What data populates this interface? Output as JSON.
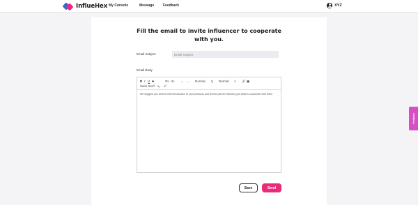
{
  "brand": {
    "name": "InflueHex",
    "accent": "#ea2a7b",
    "accent_secondary": "#2f6bd6"
  },
  "nav": {
    "links": [
      "My Console",
      "Message",
      "Feedback"
    ],
    "user": {
      "name": "XYZ",
      "icon": "user-circle-icon"
    }
  },
  "form": {
    "title_line1": "Fill the email to invite influencer to cooperate",
    "title_line2": "with you.",
    "subject_label": "Email Subject",
    "subject_placeholder": "Email Subject",
    "subject_value": "",
    "body_label": "Email Body",
    "toolbar": {
      "bold": "B",
      "italic": "I",
      "underline": "U",
      "strike": "S",
      "ordered_list": "OL",
      "bullet_list": "UL",
      "indent": "→",
      "outdent": "←",
      "header_select": "Normal",
      "font_size": "Ɣ",
      "font_select": "Normal",
      "align": "≡",
      "link": "🔗",
      "image": "▣",
      "clean": "Tx",
      "sans_serif_select": "Sans Serif",
      "sub": "x₂",
      "sup": "x²"
    },
    "body_text": "We suggest you send a brief introduction of your products and tell the partner that why you want to cooperate with them"
  },
  "buttons": {
    "save": "Save",
    "send": "Send"
  },
  "feedback_tab": {
    "label": "Feedback",
    "color": "#d84fc4"
  }
}
